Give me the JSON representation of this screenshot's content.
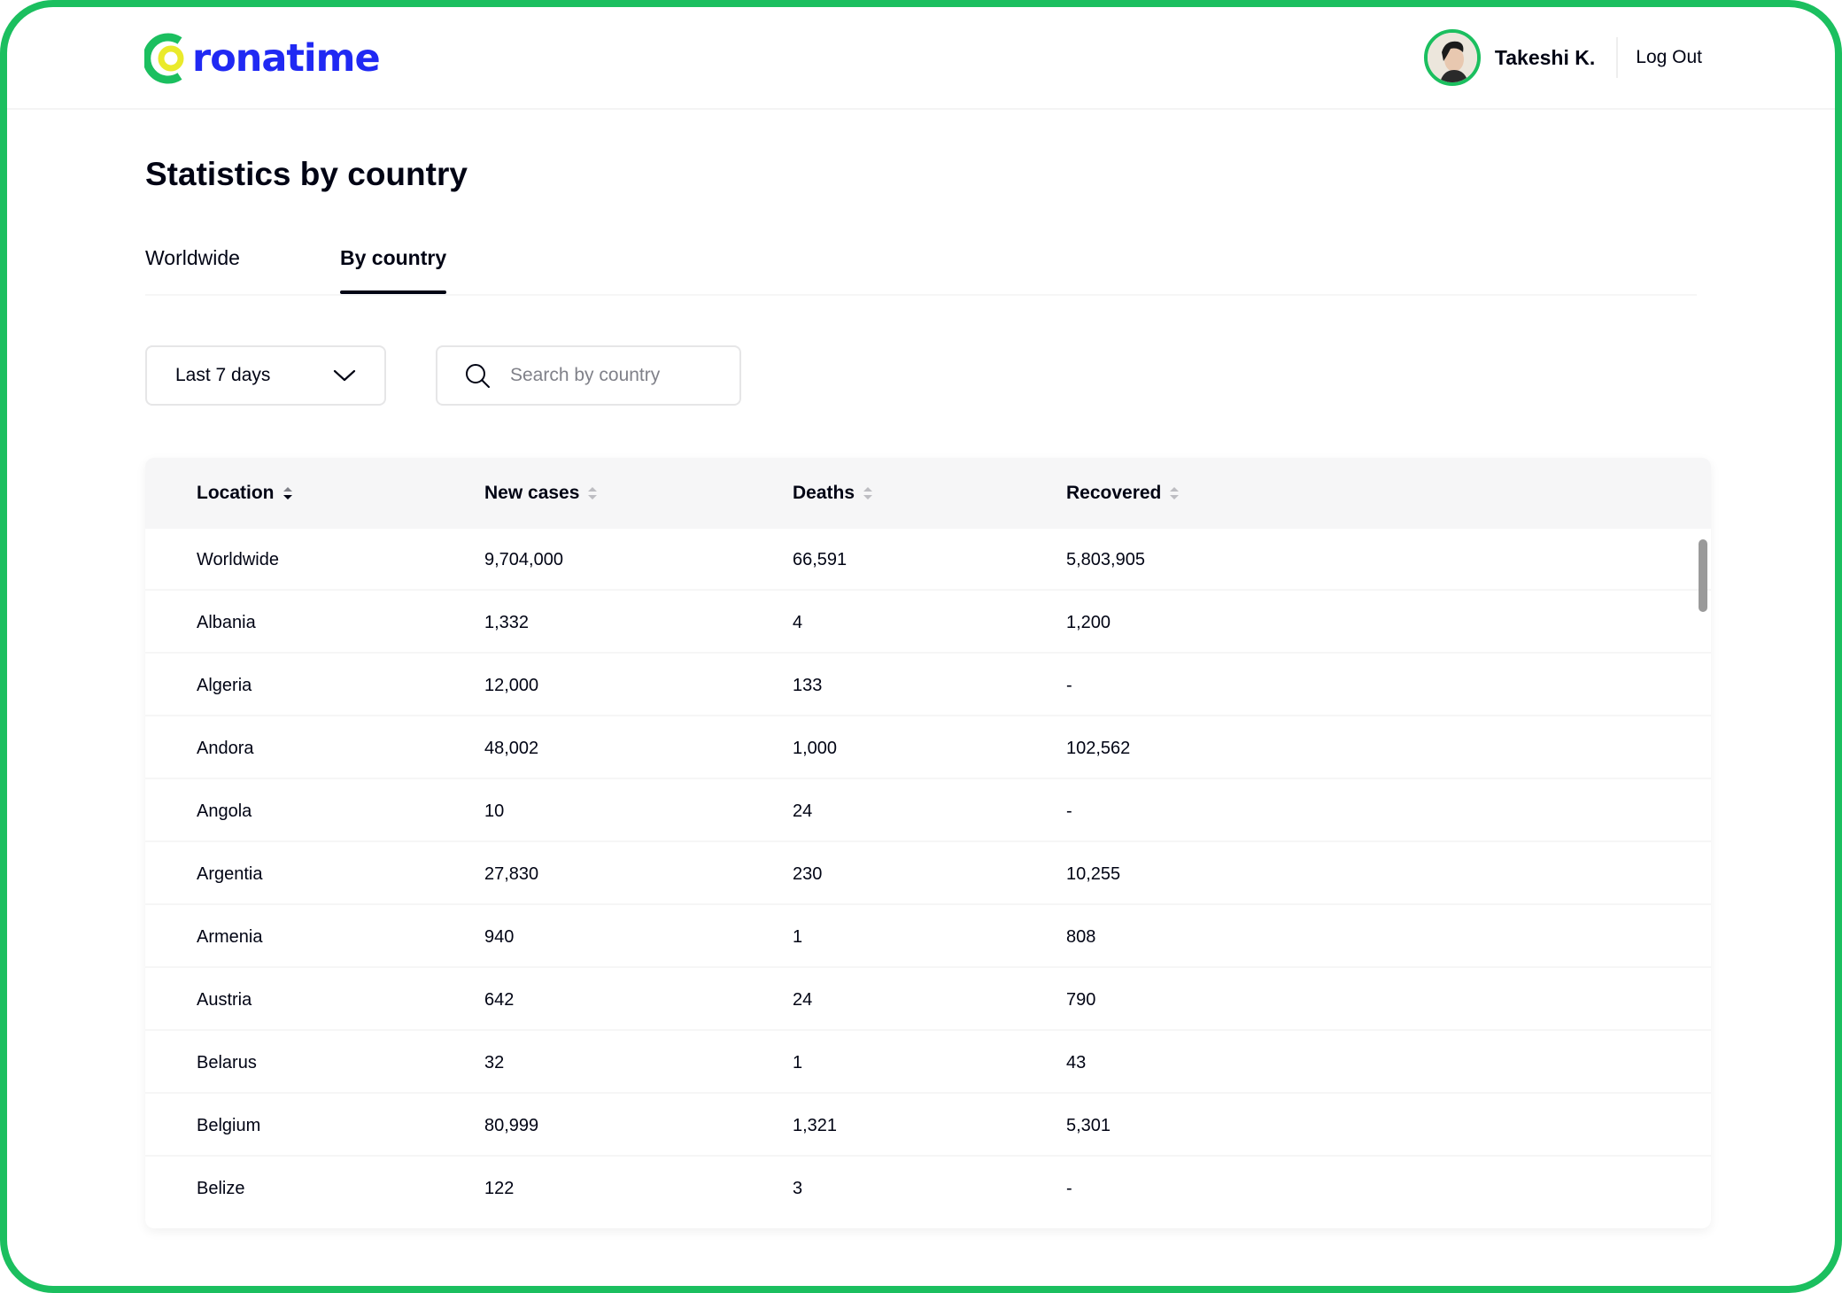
{
  "app": {
    "logo_text": "ronatime",
    "logo_colors": {
      "ring": "#1bbf5f",
      "dot": "#eaea2b",
      "text": "#2029f3"
    }
  },
  "user": {
    "name": "Takeshi K.",
    "logout_label": "Log Out"
  },
  "page": {
    "title": "Statistics by country"
  },
  "tabs": [
    {
      "label": "Worldwide",
      "active": false
    },
    {
      "label": "By country",
      "active": true
    }
  ],
  "filters": {
    "period": "Last 7 days",
    "search_placeholder": "Search by country"
  },
  "table": {
    "columns": [
      "Location",
      "New cases",
      "Deaths",
      "Recovered"
    ],
    "rows": [
      [
        "Worldwide",
        "9,704,000",
        "66,591",
        "5,803,905"
      ],
      [
        "Albania",
        "1,332",
        "4",
        "1,200"
      ],
      [
        "Algeria",
        "12,000",
        "133",
        "-"
      ],
      [
        "Andora",
        "48,002",
        "1,000",
        "102,562"
      ],
      [
        "Angola",
        "10",
        "24",
        "-"
      ],
      [
        "Argentia",
        "27,830",
        "230",
        "10,255"
      ],
      [
        "Armenia",
        "940",
        "1",
        "808"
      ],
      [
        "Austria",
        "642",
        "24",
        "790"
      ],
      [
        "Belarus",
        "32",
        "1",
        "43"
      ],
      [
        "Belgium",
        "80,999",
        "1,321",
        "5,301"
      ],
      [
        "Belize",
        "122",
        "3",
        "-"
      ]
    ]
  },
  "colors": {
    "accent": "#1bbf5f",
    "brand": "#2029f3",
    "text": "#010414"
  }
}
